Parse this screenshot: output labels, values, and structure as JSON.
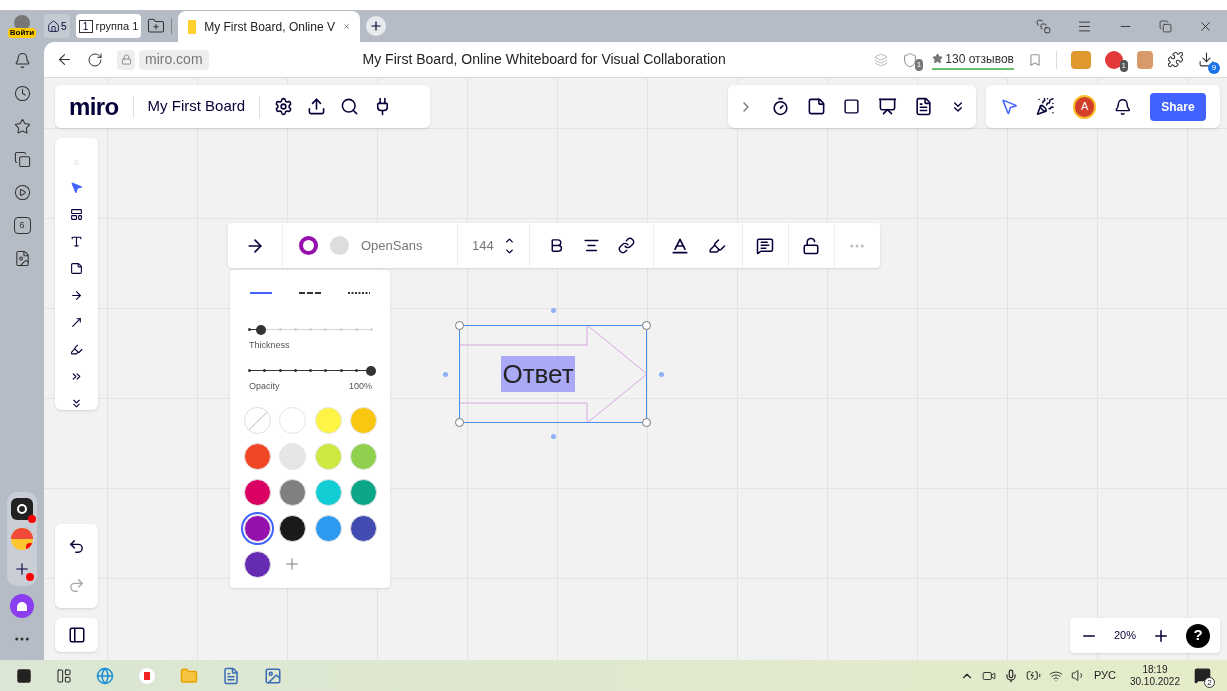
{
  "browser": {
    "profile_label": "Войти",
    "home_badge": "5",
    "tab_group": {
      "count": "1",
      "label": "группа 1"
    },
    "tab": {
      "title": "My First Board, Online V",
      "selected": true
    },
    "address": "miro.com",
    "page_title": "My First Board, Online Whiteboard for Visual Collaboration",
    "reviews": "130 отзывов",
    "shield_badge": "1",
    "adblock_badge": "1",
    "download_badge": "9",
    "sidebar_badge": "6"
  },
  "board": {
    "logo": "miro",
    "title": "My First Board",
    "avatar": "A",
    "share": "Share"
  },
  "tools": [
    {
      "kind": "select",
      "selected": true
    },
    {
      "kind": "frame",
      "selected": false
    },
    {
      "kind": "text",
      "selected": false
    },
    {
      "kind": "sticky",
      "selected": false
    },
    {
      "kind": "shape",
      "selected": false
    },
    {
      "kind": "connector",
      "selected": false
    },
    {
      "kind": "pen",
      "selected": false
    },
    {
      "kind": "more",
      "selected": false
    },
    {
      "kind": "expand",
      "selected": false
    }
  ],
  "format_bar": {
    "font": "OpenSans",
    "size": "144"
  },
  "line_styles": [
    {
      "kind": "solid",
      "selected": true
    },
    {
      "kind": "dashed",
      "selected": false
    },
    {
      "kind": "dotted",
      "selected": false
    }
  ],
  "thickness": {
    "label": "Thickness",
    "level": 0.1
  },
  "opacity": {
    "label": "Opacity",
    "reading": "100%",
    "level": 1
  },
  "swatches": [
    {
      "kind": "none",
      "selected": false
    },
    {
      "kind": "color",
      "color": "#ffffff",
      "selected": false
    },
    {
      "kind": "color",
      "color": "#fef445",
      "selected": false
    },
    {
      "kind": "color",
      "color": "#fac710",
      "selected": false
    },
    {
      "kind": "color",
      "color": "#f24726",
      "selected": false
    },
    {
      "kind": "color",
      "color": "#e6e6e6",
      "selected": false
    },
    {
      "kind": "color",
      "color": "#cee741",
      "selected": false
    },
    {
      "kind": "color",
      "color": "#8fd14f",
      "selected": false
    },
    {
      "kind": "color",
      "color": "#da0063",
      "selected": false
    },
    {
      "kind": "color",
      "color": "#808080",
      "selected": false
    },
    {
      "kind": "color",
      "color": "#12cdd4",
      "selected": false
    },
    {
      "kind": "color",
      "color": "#0ca789",
      "selected": false
    },
    {
      "kind": "color",
      "color": "#9510ac",
      "selected": true
    },
    {
      "kind": "color",
      "color": "#1a1a1a",
      "selected": false
    },
    {
      "kind": "color",
      "color": "#2d9bf0",
      "selected": false
    },
    {
      "kind": "color",
      "color": "#414bb2",
      "selected": false
    },
    {
      "kind": "color",
      "color": "#652cb3",
      "selected": false
    }
  ],
  "shape": {
    "text": "Ответ"
  },
  "zoom": {
    "reading": "20%",
    "help": "?"
  },
  "taskbar": {
    "language": "РУС",
    "time": "18:19",
    "date": "30.10.2022",
    "notifications": "2"
  }
}
